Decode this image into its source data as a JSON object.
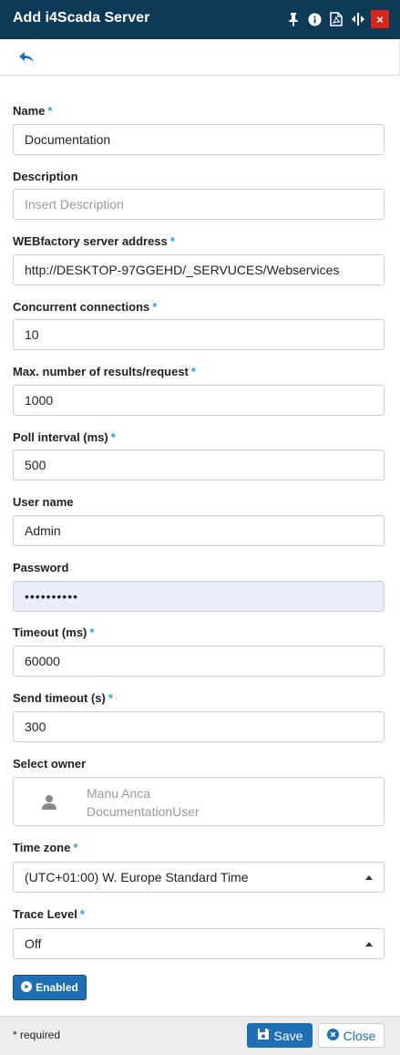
{
  "window": {
    "title": "Add i4Scada Server",
    "icons": [
      "pin-icon",
      "info-icon",
      "pdf-icon",
      "resize-icon",
      "close-icon"
    ],
    "close_glyph": "×"
  },
  "colors": {
    "header": "#0d3a57",
    "accent": "#1f6fb5",
    "required": "#2a9fd6",
    "close": "#d9261c"
  },
  "form": {
    "name": {
      "label": "Name",
      "value": "Documentation"
    },
    "description": {
      "label": "Description",
      "placeholder": "Insert Description"
    },
    "server_address": {
      "label": "WEBfactory server address",
      "value": "http://DESKTOP-97GGEHD/_SERVUCES/Webservices"
    },
    "concurrent_connections": {
      "label": "Concurrent connections",
      "value": "10"
    },
    "max_results": {
      "label": "Max. number of results/request",
      "value": "1000"
    },
    "poll_interval": {
      "label": "Poll interval (ms)",
      "value": "500"
    },
    "user_name": {
      "label": "User name",
      "value": "Admin"
    },
    "password": {
      "label": "Password",
      "value": "••••••••••"
    },
    "timeout": {
      "label": "Timeout (ms)",
      "value": "60000"
    },
    "send_timeout": {
      "label": "Send timeout (s)",
      "value": "300"
    },
    "owner": {
      "label": "Select owner",
      "name": "Manu Anca",
      "user": "DocumentationUser"
    },
    "time_zone": {
      "label": "Time zone",
      "value": "(UTC+01:00) W. Europe Standard Time"
    },
    "trace_level": {
      "label": "Trace Level",
      "value": "Off"
    },
    "enabled_button": "Enabled",
    "required_mark": "*"
  },
  "footer": {
    "required_note": "* required",
    "save_label": "Save",
    "close_label": "Close"
  }
}
